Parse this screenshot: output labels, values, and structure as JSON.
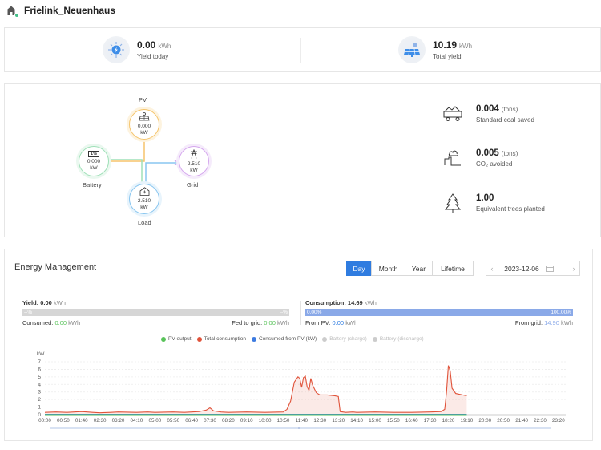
{
  "header": {
    "site_name": "Frielink_Neuenhaus"
  },
  "yield": {
    "today": {
      "value": "0.00",
      "unit": "kWh",
      "label": "Yield today"
    },
    "total": {
      "value": "10.19",
      "unit": "kWh",
      "label": "Total yield"
    }
  },
  "flow": {
    "pv": {
      "label": "PV",
      "value": "0.000",
      "unit": "kW"
    },
    "battery": {
      "label": "Battery",
      "soc": "1%",
      "value": "0.000",
      "unit": "kW"
    },
    "grid": {
      "label": "Grid",
      "value": "2.510",
      "unit": "kW"
    },
    "load": {
      "label": "Load",
      "value": "2.510",
      "unit": "kW"
    }
  },
  "environment": [
    {
      "icon": "coal-truck-icon",
      "value": "0.004",
      "unit": "(tons)",
      "label": "Standard coal saved"
    },
    {
      "icon": "factory-co2-icon",
      "value": "0.005",
      "unit": "(tons)",
      "label": "CO₂ avoided"
    },
    {
      "icon": "tree-icon",
      "value": "1.00",
      "unit": "",
      "label": "Equivalent trees planted"
    }
  ],
  "energy_management": {
    "title": "Energy Management",
    "tabs": [
      "Day",
      "Month",
      "Year",
      "Lifetime"
    ],
    "active_tab": "Day",
    "date": "2023-12-06",
    "yield": {
      "title": "Yield:",
      "value": "0.00",
      "unit": "kWh",
      "bar_left": "--%",
      "bar_right": "--%",
      "consumed_label": "Consumed:",
      "consumed_value": "0.00",
      "consumed_unit": "kWh",
      "fed_label": "Fed to grid:",
      "fed_value": "0.00",
      "fed_unit": "kWh"
    },
    "consumption": {
      "title": "Consumption:",
      "value": "14.69",
      "unit": "kWh",
      "bar_left": "0.00%",
      "bar_right": "100.00%",
      "from_pv_label": "From PV:",
      "from_pv_value": "0.00",
      "from_pv_unit": "kWh",
      "from_grid_label": "From grid:",
      "from_grid_value": "14.90",
      "from_grid_unit": "kWh"
    },
    "legend": [
      {
        "name": "PV output",
        "color": "#59c35a",
        "active": true
      },
      {
        "name": "Total consumption",
        "color": "#e0533a",
        "active": true
      },
      {
        "name": "Consumed from PV (kW)",
        "color": "#3d7be0",
        "active": true
      },
      {
        "name": "Battery (charge)",
        "color": "#cccccc",
        "active": false
      },
      {
        "name": "Battery (discharge)",
        "color": "#cccccc",
        "active": false
      }
    ]
  },
  "chart_data": {
    "type": "line",
    "ylabel": "kW",
    "ylim": [
      0,
      7
    ],
    "yticks": [
      "0",
      "1",
      "2",
      "3",
      "4",
      "5",
      "6",
      "7"
    ],
    "xticks": [
      "00:00",
      "00:50",
      "01:40",
      "02:30",
      "03:20",
      "04:10",
      "05:00",
      "05:50",
      "06:40",
      "07:30",
      "08:20",
      "09:10",
      "10:00",
      "10:50",
      "11:40",
      "12:30",
      "13:20",
      "14:10",
      "15:00",
      "15:50",
      "16:40",
      "17:30",
      "18:20",
      "19:10",
      "20:00",
      "20:50",
      "21:40",
      "22:30",
      "23:20"
    ],
    "series": [
      {
        "name": "Total consumption",
        "color": "#e0533a",
        "points": [
          [
            "00:00",
            0.3
          ],
          [
            "00:30",
            0.35
          ],
          [
            "01:00",
            0.3
          ],
          [
            "01:40",
            0.4
          ],
          [
            "02:10",
            0.3
          ],
          [
            "02:30",
            0.25
          ],
          [
            "03:00",
            0.3
          ],
          [
            "03:20",
            0.35
          ],
          [
            "04:10",
            0.3
          ],
          [
            "04:40",
            0.35
          ],
          [
            "05:00",
            0.3
          ],
          [
            "05:50",
            0.35
          ],
          [
            "06:20",
            0.3
          ],
          [
            "06:40",
            0.35
          ],
          [
            "07:00",
            0.4
          ],
          [
            "07:20",
            0.6
          ],
          [
            "07:30",
            0.9
          ],
          [
            "07:40",
            0.5
          ],
          [
            "08:00",
            0.35
          ],
          [
            "08:20",
            0.3
          ],
          [
            "09:10",
            0.35
          ],
          [
            "10:00",
            0.3
          ],
          [
            "10:50",
            0.35
          ],
          [
            "11:00",
            0.7
          ],
          [
            "11:10",
            1.8
          ],
          [
            "11:20",
            4.3
          ],
          [
            "11:30",
            5.0
          ],
          [
            "11:35",
            4.8
          ],
          [
            "11:40",
            3.6
          ],
          [
            "11:45",
            4.9
          ],
          [
            "11:50",
            5.1
          ],
          [
            "11:55",
            3.7
          ],
          [
            "12:00",
            3.2
          ],
          [
            "12:05",
            4.8
          ],
          [
            "12:10",
            3.9
          ],
          [
            "12:20",
            2.9
          ],
          [
            "12:30",
            2.6
          ],
          [
            "12:50",
            2.6
          ],
          [
            "13:10",
            2.5
          ],
          [
            "13:20",
            2.4
          ],
          [
            "13:25",
            0.4
          ],
          [
            "13:40",
            0.3
          ],
          [
            "14:00",
            0.35
          ],
          [
            "14:10",
            0.3
          ],
          [
            "15:00",
            0.35
          ],
          [
            "15:50",
            0.3
          ],
          [
            "16:40",
            0.3
          ],
          [
            "17:30",
            0.35
          ],
          [
            "18:00",
            0.4
          ],
          [
            "18:10",
            0.7
          ],
          [
            "18:15",
            3.0
          ],
          [
            "18:20",
            6.5
          ],
          [
            "18:25",
            5.8
          ],
          [
            "18:30",
            3.5
          ],
          [
            "18:40",
            2.8
          ],
          [
            "18:50",
            2.7
          ],
          [
            "19:00",
            2.6
          ],
          [
            "19:10",
            2.5
          ]
        ]
      },
      {
        "name": "Consumed from PV (kW)",
        "color": "#3d7be0",
        "points": [
          [
            "00:00",
            0.05
          ],
          [
            "19:10",
            0.05
          ]
        ]
      },
      {
        "name": "PV output",
        "color": "#59c35a",
        "points": [
          [
            "00:00",
            0
          ],
          [
            "19:10",
            0
          ]
        ]
      }
    ]
  }
}
